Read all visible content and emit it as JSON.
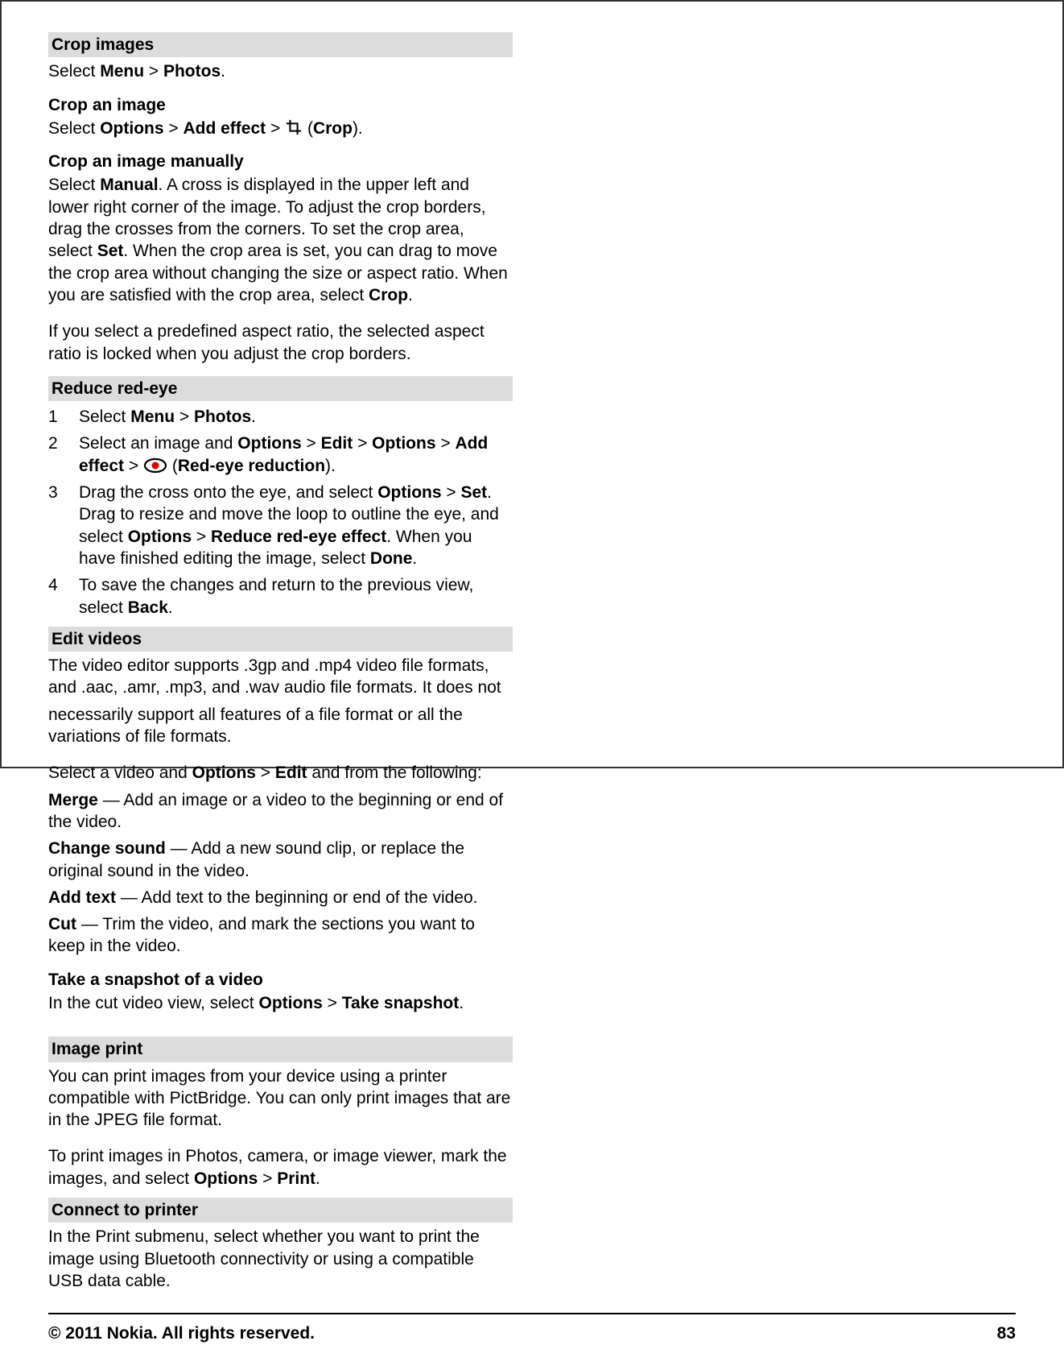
{
  "left": {
    "cropImages": {
      "heading": "Crop images",
      "line1_pre": "Select ",
      "line1_b1": "Menu",
      "line1_sep": " > ",
      "line1_b2": "Photos",
      "line1_post": "."
    },
    "cropAnImage": {
      "heading": "Crop an image",
      "line_pre": "Select ",
      "b1": "Options",
      "sep1": " > ",
      "b2": "Add effect",
      "sep2": " > ",
      "paren_open": " (",
      "b3": "Crop",
      "paren_close": ")."
    },
    "cropManually": {
      "heading": "Crop an image manually",
      "p1_pre": "Select ",
      "p1_b1": "Manual",
      "p1_mid1": ". A cross is displayed in the upper left and lower right corner of the image. To adjust the crop borders, drag the crosses from the corners. To set the crop area, select ",
      "p1_b2": "Set",
      "p1_mid2": ". When the crop area is set, you can drag to move the crop area without changing the size or aspect ratio. When you are satisfied with the crop area, select ",
      "p1_b3": "Crop",
      "p1_post": ".",
      "p2": "If you select a predefined aspect ratio, the selected aspect ratio is locked when you adjust the crop borders."
    },
    "reduceRedEye": {
      "heading": "Reduce red-eye",
      "items": [
        {
          "num": "1",
          "pre": "Select ",
          "b1": "Menu",
          "sep1": " > ",
          "b2": "Photos",
          "post": "."
        },
        {
          "num": "2",
          "pre": "Select an image and ",
          "b1": "Options",
          "sep1": " > ",
          "b2": "Edit",
          "sep2": " > ",
          "b3": "Options",
          "sep3": " > ",
          "b4": "Add effect",
          "sep4": " > ",
          "paren_open": " (",
          "b5": "Red-eye reduction",
          "paren_close": ")."
        },
        {
          "num": "3",
          "pre": "Drag the cross onto the eye, and select ",
          "b1": "Options",
          "sep1": " > ",
          "b2": "Set",
          "mid1": ". Drag to resize and move the loop to outline the eye, and select ",
          "b3": "Options",
          "sep2": " > ",
          "b4": "Reduce red-eye effect",
          "mid2": ". When you have finished editing the image, select ",
          "b5": "Done",
          "post": "."
        },
        {
          "num": "4",
          "pre": "To save the changes and return to the previous view, select ",
          "b1": "Back",
          "post": "."
        }
      ]
    },
    "editVideos": {
      "heading": "Edit videos",
      "p1": "The video editor supports .3gp and .mp4 video file formats, and .aac, .amr, .mp3, and .wav audio file formats. It does not"
    }
  },
  "right": {
    "continuation": {
      "p1": "necessarily support all features of a file format or all the variations of file formats.",
      "p2_pre": "Select a video and ",
      "p2_b1": "Options",
      "p2_sep": " > ",
      "p2_b2": "Edit",
      "p2_post": " and from the following:"
    },
    "defs": {
      "merge_b": "Merge",
      "merge_t": " — Add an image or a video to the beginning or end of the video.",
      "changeSound_b": "Change sound",
      "changeSound_t": " — Add a new sound clip, or replace the original sound in the video.",
      "addText_b": "Add text",
      "addText_t": " — Add text to the beginning or end of the video.",
      "cut_b": "Cut",
      "cut_t": " — Trim the video, and mark the sections you want to keep in the video."
    },
    "snapshot": {
      "heading": "Take a snapshot of a video",
      "pre": "In the cut video view, select ",
      "b1": "Options",
      "sep": " > ",
      "b2": "Take snapshot",
      "post": "."
    },
    "imagePrint": {
      "heading": "Image print",
      "p1": "You can print images from your device using a printer compatible with PictBridge. You can only print images that are in the JPEG file format.",
      "p2_pre": "To print images in Photos, camera, or image viewer, mark the images, and select ",
      "p2_b1": "Options",
      "p2_sep": " > ",
      "p2_b2": "Print",
      "p2_post": "."
    },
    "connectPrinter": {
      "heading": "Connect to printer",
      "p1": "In the Print submenu, select whether you want to print the image using Bluetooth connectivity or using a compatible USB data cable."
    }
  },
  "footer": {
    "left": "© 2011 Nokia. All rights reserved.",
    "right": "83"
  },
  "icons": {
    "crop": "crop-icon",
    "redeye": "redeye-icon"
  }
}
